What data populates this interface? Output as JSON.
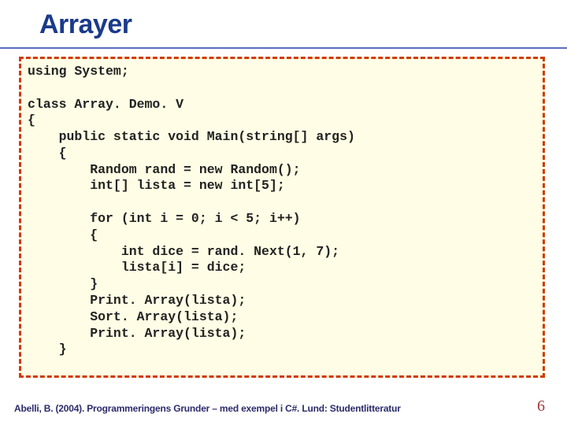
{
  "title": "Arrayer",
  "code_lines": [
    "using System;",
    "",
    "class Array. Demo. V",
    "{",
    "    public static void Main(string[] args)",
    "    {",
    "        Random rand = new Random();",
    "        int[] lista = new int[5];",
    "",
    "        for (int i = 0; i < 5; i++)",
    "        {",
    "            int dice = rand. Next(1, 7);",
    "            lista[i] = dice;",
    "        }",
    "        Print. Array(lista);",
    "        Sort. Array(lista);",
    "        Print. Array(lista);",
    "    }"
  ],
  "footer": "Abelli, B. (2004). Programmeringens Grunder – med exempel i C#. Lund: Studentlitteratur",
  "page_number": "6"
}
